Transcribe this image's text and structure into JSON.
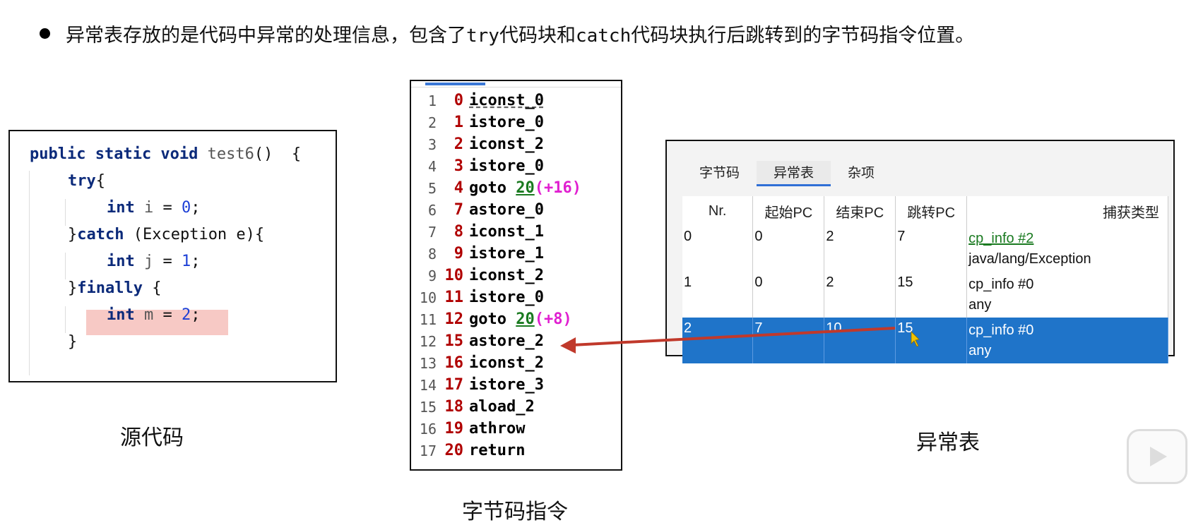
{
  "header": {
    "part1": "异常表存放的是代码中异常的处理信息，包含了",
    "kw_try": "try",
    "part2": "代码块和",
    "kw_catch": "catch",
    "part3": "代码块执行后跳转到的字节码指令位置。"
  },
  "source": {
    "caption": "源代码",
    "lines": {
      "l1_kw": "public static void",
      "l1_fn": "test6",
      "l1_rest": "()  {",
      "l2_kw": "try",
      "l2_rest": "{",
      "l3_kw": "int",
      "l3_var": "i",
      "l3_eq": " = ",
      "l3_num": "0",
      "l3_end": ";",
      "l4_pre": "}",
      "l4_kw": "catch",
      "l4_rest": " (Exception e){",
      "l5_kw": "int",
      "l5_var": "j",
      "l5_eq": " = ",
      "l5_num": "1",
      "l5_end": ";",
      "l6_pre": "}",
      "l6_kw": "finally",
      "l6_rest": " {",
      "l7_kw": "int",
      "l7_var": "m",
      "l7_eq": " = ",
      "l7_num": "2",
      "l7_end": ";",
      "l8": "}"
    }
  },
  "bytecode": {
    "caption": "字节码指令",
    "rows": [
      {
        "ln": "1",
        "off": "0",
        "op": "iconst_0"
      },
      {
        "ln": "2",
        "off": "1",
        "op": "istore_0"
      },
      {
        "ln": "3",
        "off": "2",
        "op": "iconst_2"
      },
      {
        "ln": "4",
        "off": "3",
        "op": "istore_0"
      },
      {
        "ln": "5",
        "off": "4",
        "op": "goto ",
        "target": "20",
        "rel": "(+16)"
      },
      {
        "ln": "6",
        "off": "7",
        "op": "astore_0"
      },
      {
        "ln": "7",
        "off": "8",
        "op": "iconst_1"
      },
      {
        "ln": "8",
        "off": "9",
        "op": "istore_1"
      },
      {
        "ln": "9",
        "off": "10",
        "op": "iconst_2"
      },
      {
        "ln": "10",
        "off": "11",
        "op": "istore_0"
      },
      {
        "ln": "11",
        "off": "12",
        "op": "goto ",
        "target": "20",
        "rel": "(+8)"
      },
      {
        "ln": "12",
        "off": "15",
        "op": "astore_2"
      },
      {
        "ln": "13",
        "off": "16",
        "op": "iconst_2"
      },
      {
        "ln": "14",
        "off": "17",
        "op": "istore_3"
      },
      {
        "ln": "15",
        "off": "18",
        "op": "aload_2"
      },
      {
        "ln": "16",
        "off": "19",
        "op": "athrow"
      },
      {
        "ln": "17",
        "off": "20",
        "op": "return"
      }
    ]
  },
  "exception_window": {
    "caption": "异常表",
    "tabs": [
      "字节码",
      "异常表",
      "杂项"
    ],
    "active_tab": 1,
    "columns": [
      "Nr.",
      "起始PC",
      "结束PC",
      "跳转PC",
      "捕获类型"
    ],
    "rows": [
      {
        "nr": "0",
        "start": "0",
        "end": "2",
        "handler": "7",
        "type_ref": "cp_info #2",
        "type_name": "java/lang/Exception"
      },
      {
        "nr": "1",
        "start": "0",
        "end": "2",
        "handler": "15",
        "type_ref": "cp_info #0",
        "type_name": "any"
      },
      {
        "nr": "2",
        "start": "7",
        "end": "10",
        "handler": "15",
        "type_ref": "cp_info #0",
        "type_name": "any"
      }
    ],
    "selected_row": 2
  },
  "colors": {
    "arrow": "#c0392b",
    "selection": "#1f74c9",
    "highlight": "#f7c9c5"
  }
}
